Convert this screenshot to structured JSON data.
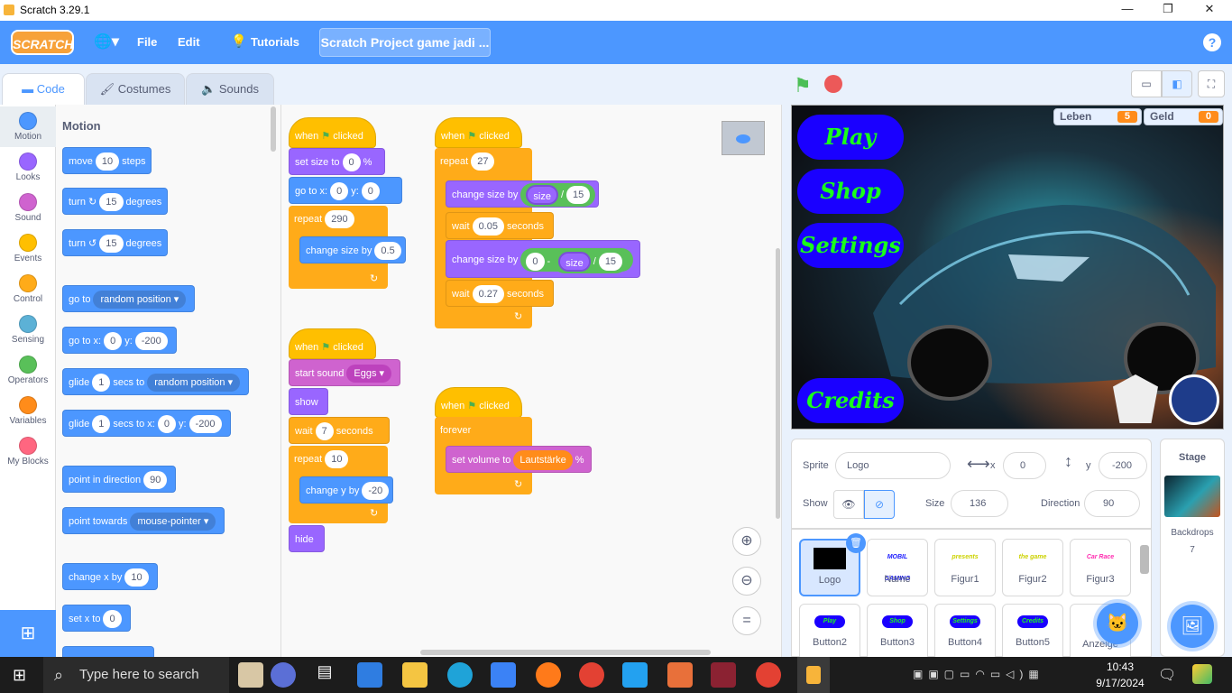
{
  "window": {
    "title": "Scratch 3.29.1"
  },
  "menu": {
    "file": "File",
    "edit": "Edit",
    "tutorials": "Tutorials",
    "project_title": "Scratch Project game jadi ...",
    "logo": "SCRATCH"
  },
  "tabs": {
    "code": "Code",
    "costumes": "Costumes",
    "sounds": "Sounds"
  },
  "categories": [
    {
      "label": "Motion",
      "color": "#4c97ff"
    },
    {
      "label": "Looks",
      "color": "#9966ff"
    },
    {
      "label": "Sound",
      "color": "#cf63cf"
    },
    {
      "label": "Events",
      "color": "#ffbf00"
    },
    {
      "label": "Control",
      "color": "#ffab19"
    },
    {
      "label": "Sensing",
      "color": "#5cb1d6"
    },
    {
      "label": "Operators",
      "color": "#59c059"
    },
    {
      "label": "Variables",
      "color": "#ff8c1a"
    },
    {
      "label": "My Blocks",
      "color": "#ff6680"
    }
  ],
  "palette": {
    "heading": "Motion",
    "move": {
      "a": "move",
      "v": "10",
      "b": "steps"
    },
    "turn_r": {
      "a": "turn",
      "v": "15",
      "b": "degrees"
    },
    "turn_l": {
      "a": "turn",
      "v": "15",
      "b": "degrees"
    },
    "goto": {
      "a": "go to",
      "d": "random position"
    },
    "gotoxy": {
      "a": "go to x:",
      "x": "0",
      "b": "y:",
      "y": "-200"
    },
    "glide1": {
      "a": "glide",
      "v": "1",
      "b": "secs to",
      "d": "random position"
    },
    "glide2": {
      "a": "glide",
      "v": "1",
      "b": "secs to x:",
      "x": "0",
      "c": "y:",
      "y": "-200"
    },
    "point": {
      "a": "point in direction",
      "v": "90"
    },
    "towards": {
      "a": "point towards",
      "d": "mouse-pointer"
    },
    "changex": {
      "a": "change x by",
      "v": "10"
    },
    "setx": {
      "a": "set x to",
      "v": "0"
    }
  },
  "script1": {
    "hat": "when",
    "hat2": "clicked",
    "setsize": "set size to",
    "setsize_v": "0",
    "pct": "%",
    "goto": "go to x:",
    "gx": "0",
    "gy_l": "y:",
    "gy": "0",
    "repeat": "repeat",
    "repeat_v": "290",
    "change": "change size by",
    "change_v": "0.5"
  },
  "script2": {
    "hat": "when",
    "hat2": "clicked",
    "repeat": "repeat",
    "repeat_v": "27",
    "cs1": "change size by",
    "size1": "size",
    "div1": "/",
    "n1": "15",
    "wait1": "wait",
    "w1": "0.05",
    "sec1": "seconds",
    "cs2": "change size by",
    "z": "0",
    "minus": "-",
    "size2": "size",
    "div2": "/",
    "n2": "15",
    "wait2": "wait",
    "w2": "0.27",
    "sec2": "seconds"
  },
  "script3": {
    "hat": "when",
    "hat2": "clicked",
    "sound": "start sound",
    "sound_v": "Eggs",
    "show": "show",
    "wait": "wait",
    "wait_v": "7",
    "sec": "seconds",
    "repeat": "repeat",
    "repeat_v": "10",
    "changey": "change y by",
    "changey_v": "-20",
    "hide": "hide"
  },
  "script4": {
    "hat": "when",
    "hat2": "clicked",
    "forever": "forever",
    "setvol": "set volume to",
    "var": "Lautstärke",
    "pct": "%"
  },
  "stage": {
    "buttons": [
      "Play",
      "Shop",
      "Settings",
      "Credits"
    ],
    "monitors": [
      {
        "label": "Leben",
        "value": "5"
      },
      {
        "label": "Geld",
        "value": "0"
      }
    ]
  },
  "sprite_info": {
    "sprite_label": "Sprite",
    "sprite_name": "Logo",
    "x_label": "x",
    "x": "0",
    "y_label": "y",
    "y": "-200",
    "show_label": "Show",
    "size_label": "Size",
    "size": "136",
    "direction_label": "Direction",
    "direction": "90"
  },
  "sprites": [
    {
      "name": "Logo",
      "img": ""
    },
    {
      "name": "Name",
      "img": "MOBIL GAMING"
    },
    {
      "name": "Figur1",
      "img": "presents"
    },
    {
      "name": "Figur2",
      "img": "the game"
    },
    {
      "name": "Figur3",
      "img": "Car Race"
    },
    {
      "name": "Button2",
      "img": "Play"
    },
    {
      "name": "Button3",
      "img": "Shop"
    },
    {
      "name": "Button4",
      "img": "Settings"
    },
    {
      "name": "Button5",
      "img": "Credits"
    },
    {
      "name": "Anzeige",
      "img": ""
    }
  ],
  "stage_pane": {
    "title": "Stage",
    "backdrops_label": "Backdrops",
    "backdrops_count": "7"
  },
  "taskbar": {
    "search": "Type here to search",
    "time": "10:43",
    "date": "9/17/2024"
  }
}
